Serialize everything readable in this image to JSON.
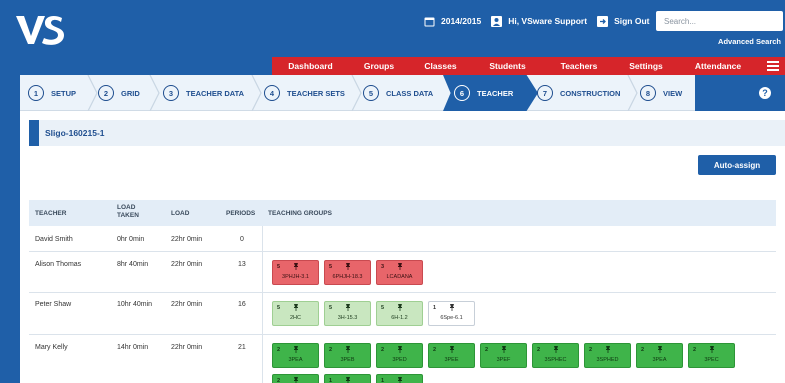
{
  "header": {
    "year": "2014/2015",
    "user_greeting": "Hi, VSware Support",
    "sign_out": "Sign Out",
    "search_placeholder": "Search...",
    "advanced_search": "Advanced Search"
  },
  "nav": {
    "items": [
      "Dashboard",
      "Groups",
      "Classes",
      "Students",
      "Teachers",
      "Settings",
      "Attendance"
    ],
    "color": "#d6252a"
  },
  "wizard": {
    "steps": [
      {
        "num": "1",
        "label": "SETUP"
      },
      {
        "num": "2",
        "label": "GRID"
      },
      {
        "num": "3",
        "label": "TEACHER DATA"
      },
      {
        "num": "4",
        "label": "TEACHER SETS"
      },
      {
        "num": "5",
        "label": "CLASS DATA"
      },
      {
        "num": "6",
        "label": "TEACHER",
        "active": true
      },
      {
        "num": "7",
        "label": "CONSTRUCTION"
      },
      {
        "num": "8",
        "label": "VIEW"
      }
    ]
  },
  "school": "Sligo-160215-1",
  "auto_assign": "Auto-assign",
  "table": {
    "headers": {
      "teacher": "TEACHER",
      "load_taken": "LOAD TAKEN",
      "load": "LOAD",
      "periods": "PERIODS",
      "groups": "TEACHING GROUPS"
    },
    "rows": [
      {
        "teacher": "David Smith",
        "load_taken": "0hr 0min",
        "load": "22hr 0min",
        "periods": "0"
      },
      {
        "teacher": "Alison Thomas",
        "load_taken": "8hr 40min",
        "load": "22hr 0min",
        "periods": "13"
      },
      {
        "teacher": "Peter Shaw",
        "load_taken": "10hr 40min",
        "load": "22hr 0min",
        "periods": "16"
      },
      {
        "teacher": "Mary Kelly",
        "load_taken": "14hr 0min",
        "load": "22hr 0min",
        "periods": "21"
      }
    ]
  },
  "groups": {
    "alison": [
      {
        "count": "5",
        "code": "3PHJH-3.1",
        "color": "red"
      },
      {
        "count": "5",
        "code": "6PHJH-18.3",
        "color": "red"
      },
      {
        "count": "3",
        "code": "LCADANA",
        "color": "red"
      }
    ],
    "peter": [
      {
        "count": "5",
        "code": "2HC",
        "color": "lightgreen"
      },
      {
        "count": "5",
        "code": "3H-15.3",
        "color": "lightgreen"
      },
      {
        "count": "5",
        "code": "6H-1.2",
        "color": "lightgreen"
      },
      {
        "count": "1",
        "code": "6Spe-6.1",
        "color": "white"
      }
    ],
    "mary": [
      {
        "count": "2",
        "code": "3PEA",
        "color": "green"
      },
      {
        "count": "2",
        "code": "3PEB",
        "color": "green"
      },
      {
        "count": "2",
        "code": "3PED",
        "color": "green"
      },
      {
        "count": "2",
        "code": "3PEE",
        "color": "green"
      },
      {
        "count": "2",
        "code": "3PEF",
        "color": "green"
      },
      {
        "count": "2",
        "code": "3SPHEC",
        "color": "green"
      },
      {
        "count": "2",
        "code": "3SPHED",
        "color": "green"
      },
      {
        "count": "2",
        "code": "3PEA",
        "color": "green"
      },
      {
        "count": "2",
        "code": "3PEC",
        "color": "green"
      }
    ],
    "mary_row2": [
      {
        "count": "2",
        "color": "green"
      },
      {
        "count": "1",
        "color": "green"
      },
      {
        "count": "1",
        "color": "green"
      }
    ]
  }
}
